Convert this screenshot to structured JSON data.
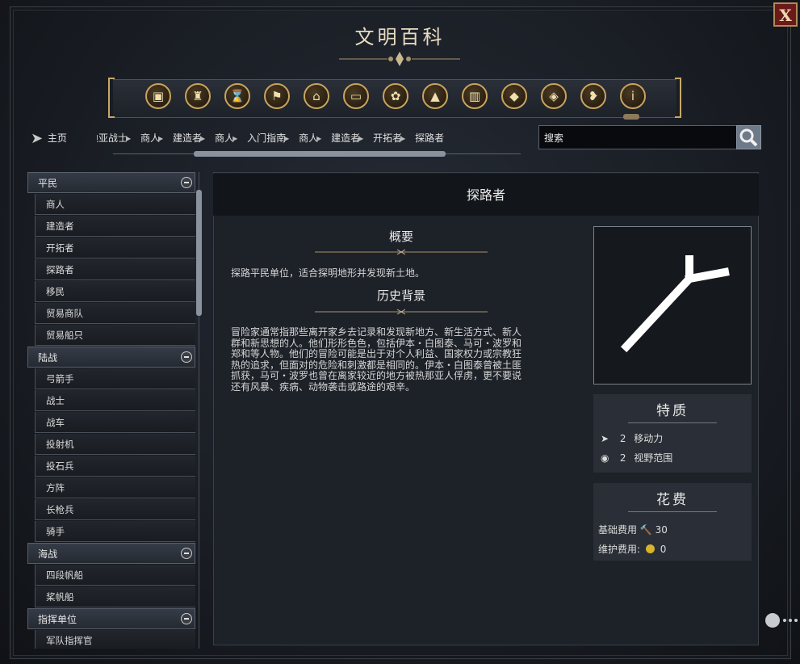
{
  "window": {
    "title": "文明百科",
    "close_label": "X"
  },
  "toolbar": {
    "icons": [
      "units-icon",
      "chalice-icon",
      "hourglass-icon",
      "flag-icon",
      "government-icon",
      "book-icon",
      "atom-icon",
      "terrain-icon",
      "city-icon",
      "diamond-icon",
      "pyramid-icon",
      "dove-icon",
      "info-icon"
    ]
  },
  "nav": {
    "home_label": "主页",
    "breadcrumbs": [
      "迪亚战士",
      "商人",
      "建造者",
      "商人",
      "入门指南",
      "商人",
      "建造者",
      "开拓者",
      "探路者"
    ],
    "search_value": "搜索"
  },
  "sidebar": {
    "categories": [
      {
        "label": "平民",
        "items": [
          "商人",
          "建造者",
          "开拓者",
          "探路者",
          "移民",
          "贸易商队",
          "贸易船只"
        ]
      },
      {
        "label": "陆战",
        "items": [
          "弓箭手",
          "战士",
          "战车",
          "投射机",
          "投石兵",
          "方阵",
          "长枪兵",
          "骑手"
        ]
      },
      {
        "label": "海战",
        "items": [
          "四段帆船",
          "桨帆船"
        ]
      },
      {
        "label": "指挥单位",
        "items": [
          "军队指挥官"
        ]
      }
    ]
  },
  "article": {
    "title": "探路者",
    "summary_heading": "概要",
    "summary_text": "探路平民单位，适合探明地形并发现新土地。",
    "history_heading": "历史背景",
    "history_lines": [
      "冒险家通常指那些离开家乡去记录和发现新地方、新生活方式、新人",
      "群和新思想的人。他们形形色色，包括伊本・白图泰、马可・波罗和",
      "郑和等人物。他们的冒险可能是出于对个人利益、国家权力或宗教狂",
      "热的追求，但面对的危险和刺激都是相同的。伊本・白图泰曾被土匪",
      "抓获，马可・波罗也曾在离家较近的地方被热那亚人俘虏，更不要说",
      "还有风暴、疾病、动物袭击或路途的艰辛。"
    ]
  },
  "traits": {
    "heading": "特质",
    "movement": {
      "value": "2",
      "label": "移动力",
      "icon": "arrow-icon"
    },
    "sight": {
      "value": "2",
      "label": "视野范围",
      "icon": "eye-icon"
    }
  },
  "cost": {
    "heading": "花费",
    "base_label": "基础费用",
    "base_value": "30",
    "base_icon": "hammer-icon",
    "upkeep_label": "维护费用:",
    "upkeep_value": "0",
    "upkeep_icon": "coin-icon"
  },
  "colors": {
    "accent_gold": "#c9a35e",
    "close_red": "#6b1a1a"
  }
}
